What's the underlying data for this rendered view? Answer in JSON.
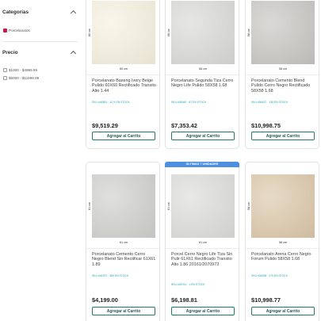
{
  "sidebar": {
    "categories": {
      "title": "Categorías",
      "options": [
        {
          "label": "Porcelanatos",
          "checked": true
        }
      ]
    },
    "price": {
      "title": "Precio",
      "options": [
        {
          "label": "$1000 - $4999.99",
          "checked": false
        },
        {
          "label": "$5000 - $11999.99",
          "checked": false
        }
      ]
    }
  },
  "products": [
    {
      "name": "Porcelanato Baseng Ivory Beige Pulido 60X60 Rectificado Transito Alto 1.44",
      "sku": "SKU #46851 · 1174 EN STOCK",
      "price": "$9,519.29",
      "dim_side": "60 cm",
      "dim_bottom": "60 cm",
      "tile_color": "#f6f1df",
      "ribbon": "",
      "button": "Agregar al Carrito"
    },
    {
      "name": "Porcelanato Segunda Tiza Cerro Negro Life Pulido 58X58 1.68",
      "sku": "SKU #36940 · 67 EN STOCK",
      "price": "$7,353.42",
      "dim_side": "58 cm",
      "dim_bottom": "58 cm",
      "tile_color": "#d9d9d7",
      "ribbon": "",
      "button": "Agregar al Carrito"
    },
    {
      "name": "Porcelanato Cemento Blend Pulido Cerro Negro Rectificado 58X58 1.68",
      "sku": "SKU #96437 · 135 EN STOCK",
      "price": "$10,998.75",
      "dim_side": "58 cm",
      "dim_bottom": "58 cm",
      "tile_color": "#c6c5c1",
      "ribbon": "",
      "button": "Agregar al Carrito"
    },
    {
      "name": "Porcelanato Cemento Cerro Negro Blend Sin Rectificar 61X61 1.89",
      "sku": "SKU #46767 · 389 EN STOCK",
      "price": "$4,199.00",
      "dim_side": "61 cm",
      "dim_bottom": "61 cm",
      "tile_color": "#cfcfcc",
      "ribbon": "",
      "button": "Agregar al Carrito"
    },
    {
      "name": "Porcel Cerro Negro Life Tiza Sin Pulir 61X61 Rectificado Transito Alto 1.86 20161/2070973",
      "sku": "SKU #46761 · 1 EN STOCK",
      "price": "$6,198.81",
      "dim_side": "61 cm",
      "dim_bottom": "61 cm",
      "tile_color": "#dcdcda",
      "ribbon": "ÚLTIMAS 7 UNIDADES",
      "button": "Agregar al Carrito"
    },
    {
      "name": "Porcelanato Arena Cerro Negro Forum Pulido 58X58 1.68",
      "sku": "SKU #36938 · 275 EN STOCK",
      "price": "$10,998.77",
      "dim_side": "58 cm",
      "dim_bottom": "58 cm",
      "tile_color": "#dbc7a8",
      "ribbon": "",
      "button": "Agregar al Carrito"
    }
  ]
}
